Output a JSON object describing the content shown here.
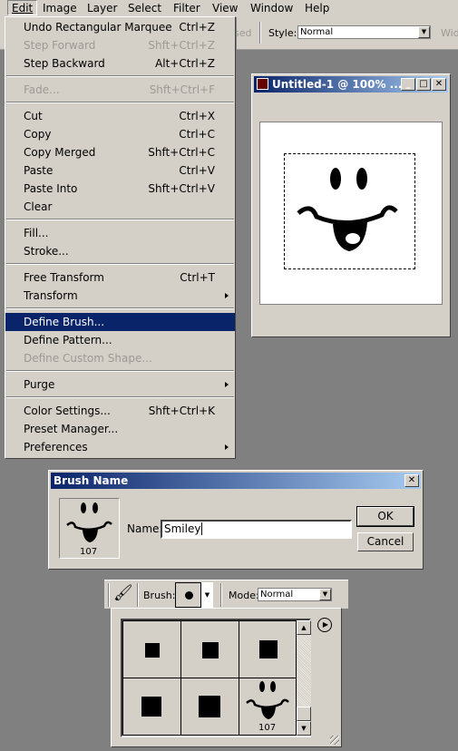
{
  "menubar": {
    "items": [
      "Edit",
      "Image",
      "Layer",
      "Select",
      "Filter",
      "View",
      "Window",
      "Help"
    ]
  },
  "options_bar": {
    "truncated_left": "sed",
    "style_label": "Style:",
    "style_value": "Normal",
    "truncated_right": "Widt"
  },
  "edit_menu": {
    "items": [
      {
        "label": "Undo Rectangular Marquee",
        "shortcut": "Ctrl+Z",
        "enabled": true
      },
      {
        "label": "Step Forward",
        "shortcut": "Shft+Ctrl+Z",
        "enabled": false
      },
      {
        "label": "Step Backward",
        "shortcut": "Alt+Ctrl+Z",
        "enabled": true
      },
      {
        "label": "Fade...",
        "shortcut": "Shft+Ctrl+F",
        "enabled": false
      },
      {
        "label": "Cut",
        "shortcut": "Ctrl+X",
        "enabled": true
      },
      {
        "label": "Copy",
        "shortcut": "Ctrl+C",
        "enabled": true
      },
      {
        "label": "Copy Merged",
        "shortcut": "Shft+Ctrl+C",
        "enabled": true
      },
      {
        "label": "Paste",
        "shortcut": "Ctrl+V",
        "enabled": true
      },
      {
        "label": "Paste Into",
        "shortcut": "Shft+Ctrl+V",
        "enabled": true
      },
      {
        "label": "Clear",
        "shortcut": "",
        "enabled": true
      },
      {
        "label": "Fill...",
        "shortcut": "",
        "enabled": true
      },
      {
        "label": "Stroke...",
        "shortcut": "",
        "enabled": true
      },
      {
        "label": "Free Transform",
        "shortcut": "Ctrl+T",
        "enabled": true
      },
      {
        "label": "Transform",
        "shortcut": "",
        "enabled": true,
        "submenu": true
      },
      {
        "label": "Define Brush...",
        "shortcut": "",
        "enabled": true,
        "highlighted": true
      },
      {
        "label": "Define Pattern...",
        "shortcut": "",
        "enabled": true
      },
      {
        "label": "Define Custom Shape...",
        "shortcut": "",
        "enabled": false
      },
      {
        "label": "Purge",
        "shortcut": "",
        "enabled": true,
        "submenu": true
      },
      {
        "label": "Color Settings...",
        "shortcut": "Shft+Ctrl+K",
        "enabled": true
      },
      {
        "label": "Preset Manager...",
        "shortcut": "",
        "enabled": true
      },
      {
        "label": "Preferences",
        "shortcut": "",
        "enabled": true,
        "submenu": true
      }
    ]
  },
  "document": {
    "title": "Untitled-1 @ 100% ..."
  },
  "brush_dialog": {
    "title": "Brush Name",
    "thumbnail_size": "107",
    "name_label": "Name:",
    "name_value": "Smiley",
    "ok": "OK",
    "cancel": "Cancel"
  },
  "brush_toolbar": {
    "brush_label": "Brush:",
    "mode_label": "Mode:",
    "mode_value": "Normal"
  },
  "brush_picker": {
    "smiley_size": "107"
  },
  "colors": {
    "highlight": "#0a246a",
    "chrome": "#d4d0c8",
    "desktop": "#808080"
  }
}
